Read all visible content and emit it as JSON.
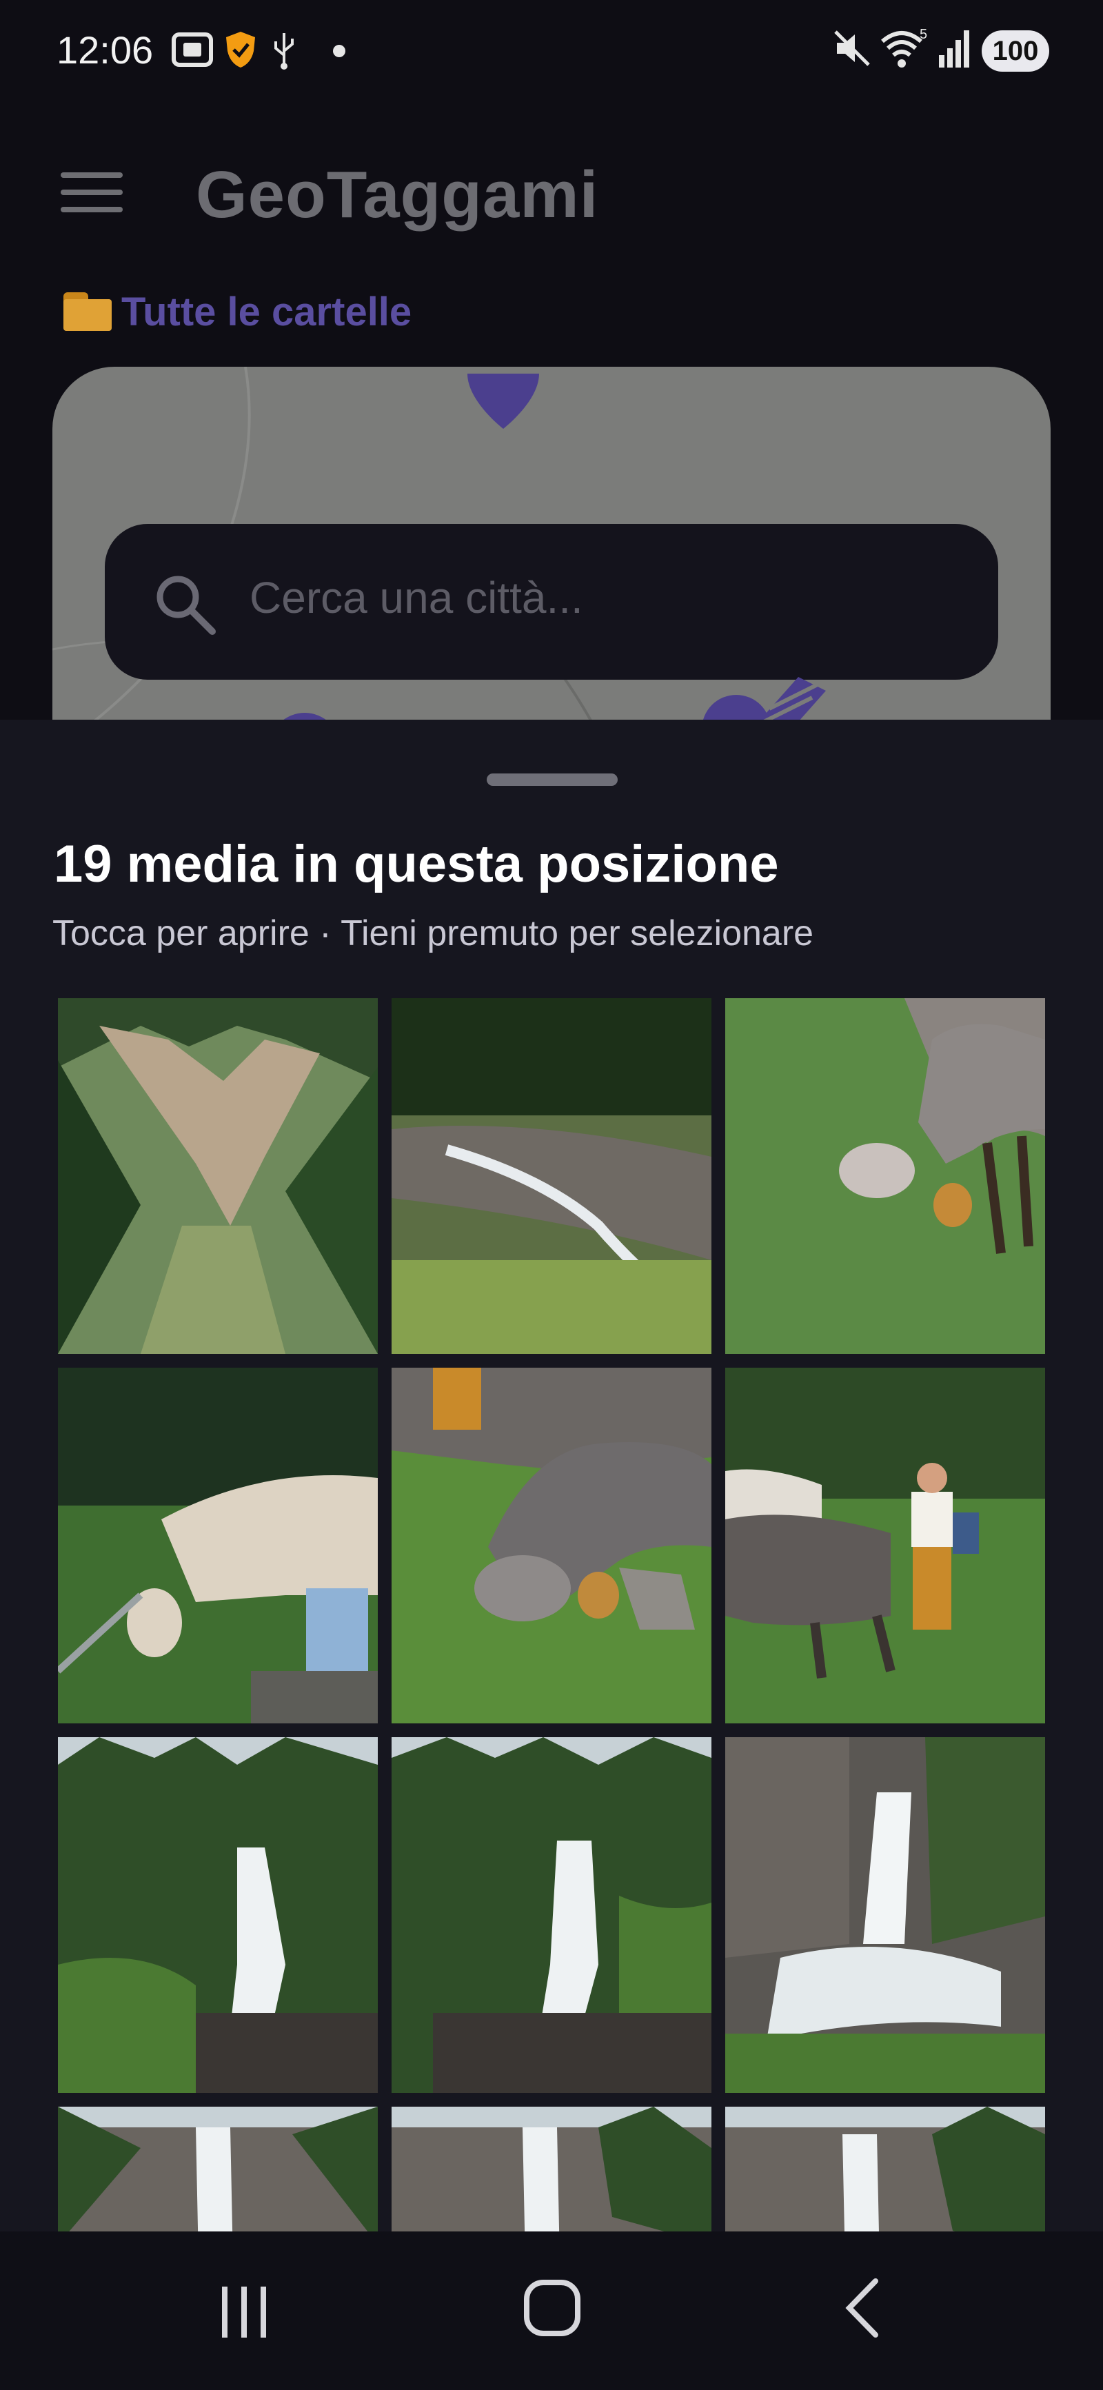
{
  "status_bar": {
    "time": "12:06",
    "battery": "100",
    "icons": [
      "screenshot-icon",
      "shield-check-icon",
      "usb-icon",
      "dot-icon",
      "mute-icon",
      "wifi-icon",
      "signal-icon"
    ]
  },
  "header": {
    "title": "GeoTaggami",
    "folder_link": "Tutte le cartelle"
  },
  "search": {
    "placeholder": "Cerca una città..."
  },
  "sheet": {
    "title": "19 media in questa posizione",
    "subtitle": "Tocca per aprire · Tieni premuto per selezionare"
  },
  "photos": [
    {
      "subject": "mountain-valley"
    },
    {
      "subject": "mountain-stream"
    },
    {
      "subject": "cow-grazing"
    },
    {
      "subject": "cow-grazing-bench"
    },
    {
      "subject": "cow-closeup"
    },
    {
      "subject": "cows-person"
    },
    {
      "subject": "waterfall"
    },
    {
      "subject": "waterfall"
    },
    {
      "subject": "waterfall"
    },
    {
      "subject": "waterfall"
    },
    {
      "subject": "waterfall"
    },
    {
      "subject": "waterfall"
    }
  ],
  "colors": {
    "accent": "#4b3f8e",
    "sheet_bg": "#16161f",
    "background": "#0e0d14"
  }
}
